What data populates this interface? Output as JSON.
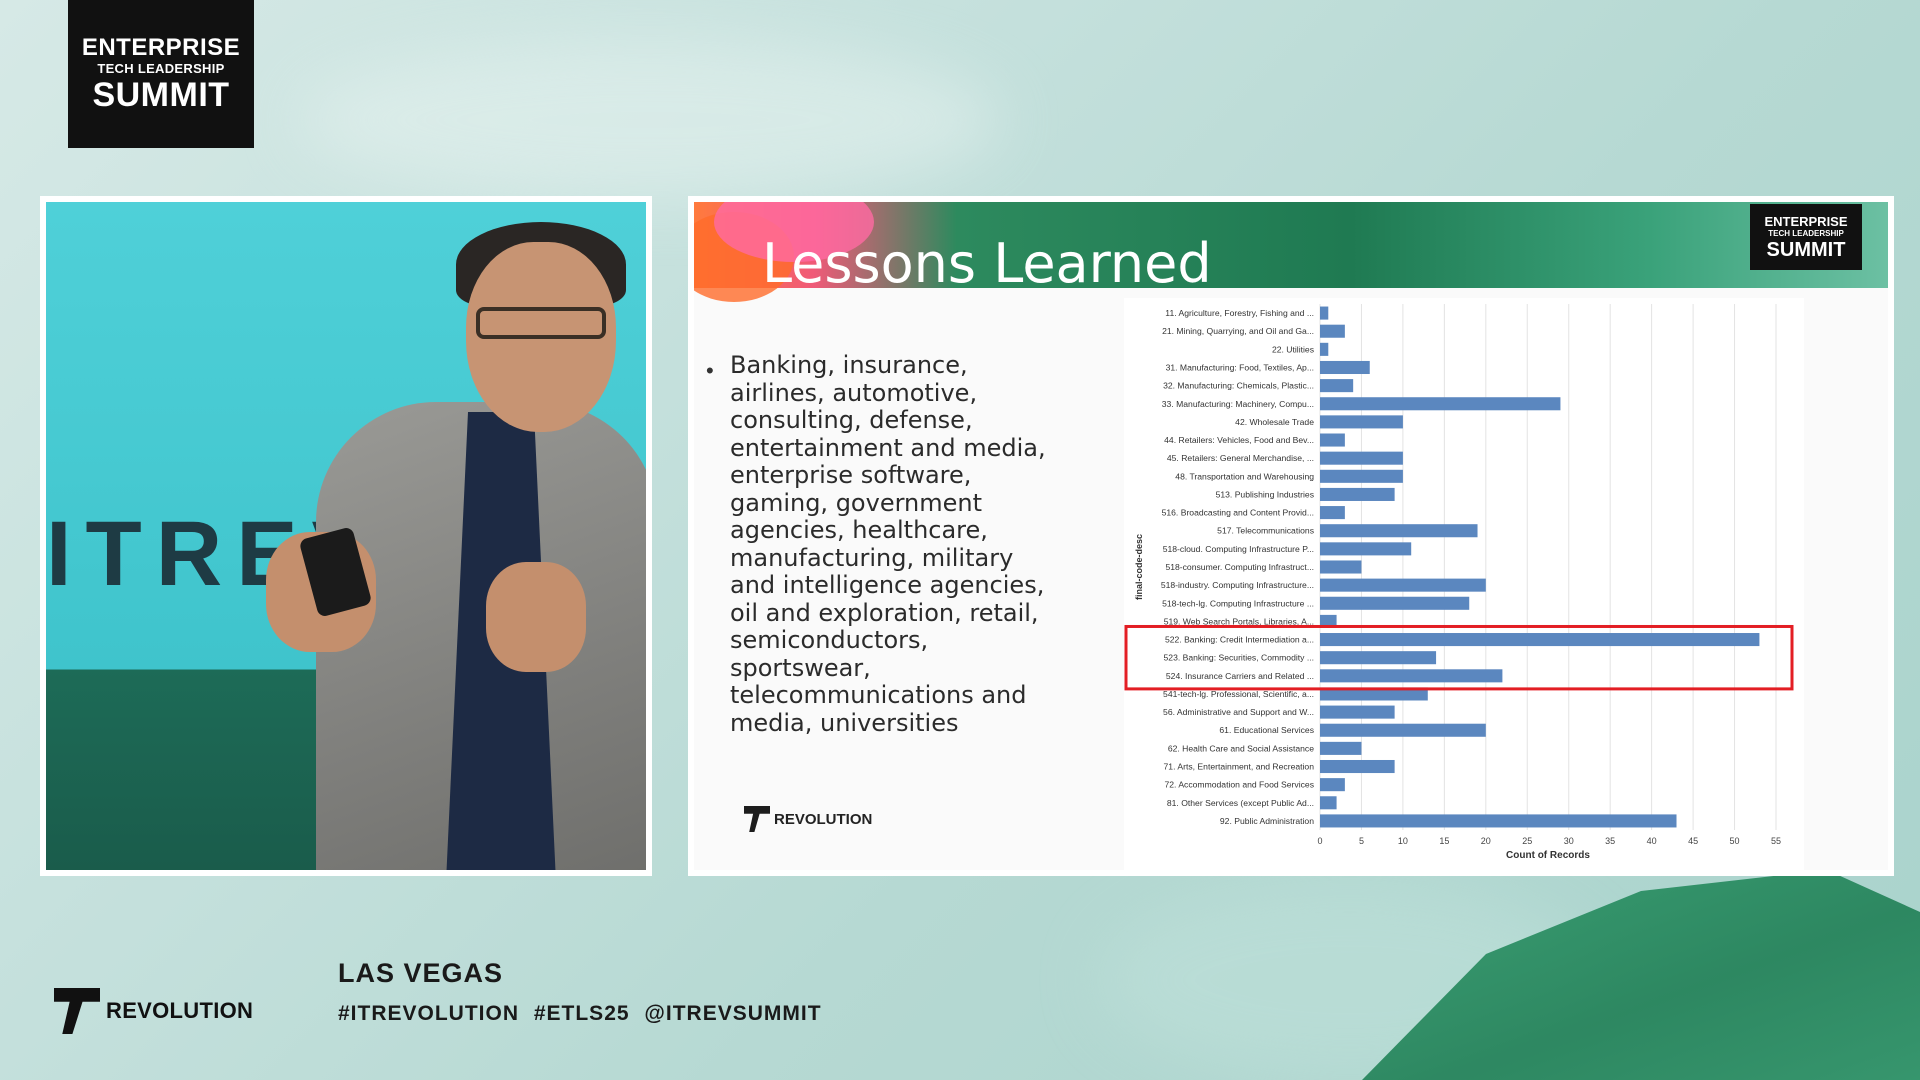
{
  "event_logo": {
    "line1": "ENTERPRISE",
    "line2": "TECH LEADERSHIP",
    "line3": "SUMMIT"
  },
  "speaker_panel": {
    "stage_backdrop_text": "ITREV"
  },
  "slide": {
    "title": "Lessons Learned",
    "logo": {
      "line1": "ENTERPRISE",
      "line2": "TECH LEADERSHIP",
      "line3": "SUMMIT"
    },
    "bullet": "Banking, insurance, airlines, automotive, consulting, defense, entertainment and media, enterprise software, gaming, government agencies, healthcare, manufacturing, military and intelligence agencies, oil and exploration, retail, semiconductors, sportswear, telecommunications and media, universities",
    "brand": "REVOLUTION",
    "chart_data": {
      "type": "bar",
      "orientation": "horizontal",
      "ylabel": "final-code-desc",
      "xlabel": "Count of Records",
      "xlim": [
        0,
        55
      ],
      "xticks": [
        0,
        5,
        10,
        15,
        20,
        25,
        30,
        35,
        40,
        45,
        50,
        55
      ],
      "grid": true,
      "highlight_color": "#e31e24",
      "bar_color": "#5b87bf",
      "categories": [
        "11. Agriculture, Forestry, Fishing and ...",
        "21. Mining, Quarrying, and Oil and Ga...",
        "22. Utilities",
        "31. Manufacturing: Food, Textiles, Ap...",
        "32. Manufacturing: Chemicals, Plastic...",
        "33. Manufacturing: Machinery, Compu...",
        "42. Wholesale Trade",
        "44. Retailers: Vehicles, Food and Bev...",
        "45. Retailers: General Merchandise, ...",
        "48. Transportation and Warehousing",
        "513. Publishing Industries",
        "516. Broadcasting and Content Provid...",
        "517. Telecommunications",
        "518-cloud. Computing Infrastructure P...",
        "518-consumer. Computing Infrastruct...",
        "518-industry. Computing Infrastructure...",
        "518-tech-lg. Computing Infrastructure ...",
        "519. Web Search Portals, Libraries, A...",
        "522. Banking: Credit Intermediation a...",
        "523. Banking: Securities, Commodity ...",
        "524. Insurance Carriers and Related ...",
        "541-tech-lg. Professional, Scientific, a...",
        "56. Administrative and Support and W...",
        "61. Educational Services",
        "62. Health Care and Social Assistance",
        "71. Arts, Entertainment, and Recreation",
        "72. Accommodation and Food Services",
        "81. Other Services (except Public Ad...",
        "92. Public Administration"
      ],
      "values": [
        1,
        3,
        1,
        6,
        4,
        29,
        10,
        3,
        10,
        10,
        9,
        3,
        19,
        11,
        5,
        20,
        18,
        2,
        53,
        14,
        22,
        13,
        9,
        20,
        5,
        9,
        3,
        2,
        43
      ],
      "highlighted_categories": [
        "522. Banking: Credit Intermediation a...",
        "523. Banking: Securities, Commodity ...",
        "524. Insurance Carriers and Related ..."
      ]
    }
  },
  "footer": {
    "brand": "REVOLUTION",
    "city": "LAS VEGAS",
    "tags": "#ITREVOLUTION #ETLS25 @ITREVSUMMIT"
  }
}
